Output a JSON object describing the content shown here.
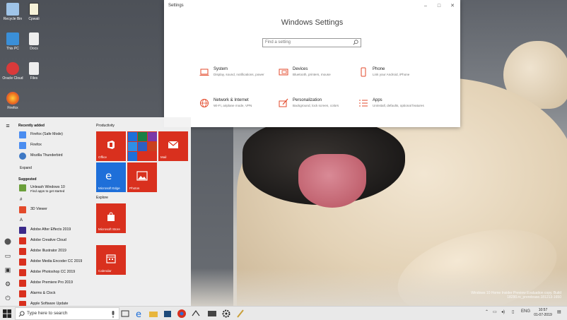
{
  "desktop": {
    "icons": [
      {
        "label": "Recycle Bin",
        "icon": "recycle-bin-icon",
        "color": "#9fc4e8"
      },
      {
        "label": "Cpwati",
        "icon": "file-icon",
        "color": "#f5f1d8"
      },
      {
        "label": "This PC",
        "icon": "computer-icon",
        "color": "#3a8fd8"
      },
      {
        "label": "Docs",
        "icon": "document-icon",
        "color": "#eeeeee"
      },
      {
        "label": "Oracle Cloud",
        "icon": "cloud-app-icon",
        "color": "#d93a3a"
      },
      {
        "label": "Files",
        "icon": "file-icon",
        "color": "#eeeeee"
      },
      {
        "label": "Firefox",
        "icon": "firefox-icon",
        "color": "#e8661c"
      }
    ],
    "watermark": "Windows 10 Home Insider Preview Evaluation copy. Build 18290.rs_prerelease.181213-1650"
  },
  "settings": {
    "window_title": "Settings",
    "minimize": "–",
    "maximize": "□",
    "close": "✕",
    "heading": "Windows Settings",
    "search_placeholder": "Find a setting",
    "categories": [
      {
        "name": "System",
        "desc": "Display, sound, notifications, power",
        "icon": "laptop-icon"
      },
      {
        "name": "Devices",
        "desc": "Bluetooth, printers, mouse",
        "icon": "keyboard-icon"
      },
      {
        "name": "Phone",
        "desc": "Link your Android, iPhone",
        "icon": "phone-icon"
      },
      {
        "name": "Network & Internet",
        "desc": "Wi-Fi, airplane mode, VPN",
        "icon": "globe-icon"
      },
      {
        "name": "Personalization",
        "desc": "Background, lock screen, colors",
        "icon": "paint-brush-icon"
      },
      {
        "name": "Apps",
        "desc": "Uninstall, defaults, optional features",
        "icon": "apps-list-icon"
      }
    ],
    "accent": "#e34a2b"
  },
  "start_menu": {
    "recently_added_title": "Recently added",
    "recent": [
      {
        "name": "Firefox (Safe Mode)",
        "color": "#4b8df0"
      },
      {
        "name": "Firefox",
        "color": "#4b8df0"
      },
      {
        "name": "Mozilla Thunderbird",
        "color": "#3e78c4"
      }
    ],
    "expand_label": "Expand",
    "suggested_title": "Suggested",
    "suggested_app": {
      "name": "Unleash Windows 10",
      "sub": "Find apps to get started",
      "color": "#6b9f3a"
    },
    "hash_letter": "#",
    "hash_app": {
      "name": "3D Viewer",
      "color": "#e34a2b"
    },
    "a_letter": "A",
    "a_apps": [
      {
        "name": "Adobe After Effects 2019",
        "color": "#3b2a8a"
      },
      {
        "name": "Adobe Creative Cloud",
        "color": "#d9301e"
      },
      {
        "name": "Adobe Illustrator 2019",
        "color": "#d9301e"
      },
      {
        "name": "Adobe Media Encoder CC 2019",
        "color": "#d9301e"
      },
      {
        "name": "Adobe Photoshop CC 2019",
        "color": "#d9301e"
      },
      {
        "name": "Adobe Premiere Pro 2019",
        "color": "#d9301e"
      },
      {
        "name": "Alarms & Clock",
        "color": "#d9301e"
      },
      {
        "name": "Apple Software Update",
        "color": "#d9301e"
      }
    ],
    "productivity_title": "Productivity",
    "explore_title": "Explore",
    "tiles": {
      "office": "Office",
      "mail": "Mail",
      "edge": "Microsoft Edge",
      "photos": "Photos",
      "store": "Microsoft Store",
      "calendar": "Calendar"
    },
    "tile_color": "#d9301e",
    "edge_color": "#1e6fd9"
  },
  "taskbar": {
    "search_placeholder": "Type here to search",
    "apps": [
      "task-view-icon",
      "edge-icon",
      "file-explorer-icon",
      "store-icon",
      "chrome-icon",
      "network-tool-icon",
      "photos-icon",
      "settings-gear-icon",
      "paint-icon"
    ],
    "tray_text": "ENG",
    "time": "10:57",
    "date": "01-07-2019"
  }
}
